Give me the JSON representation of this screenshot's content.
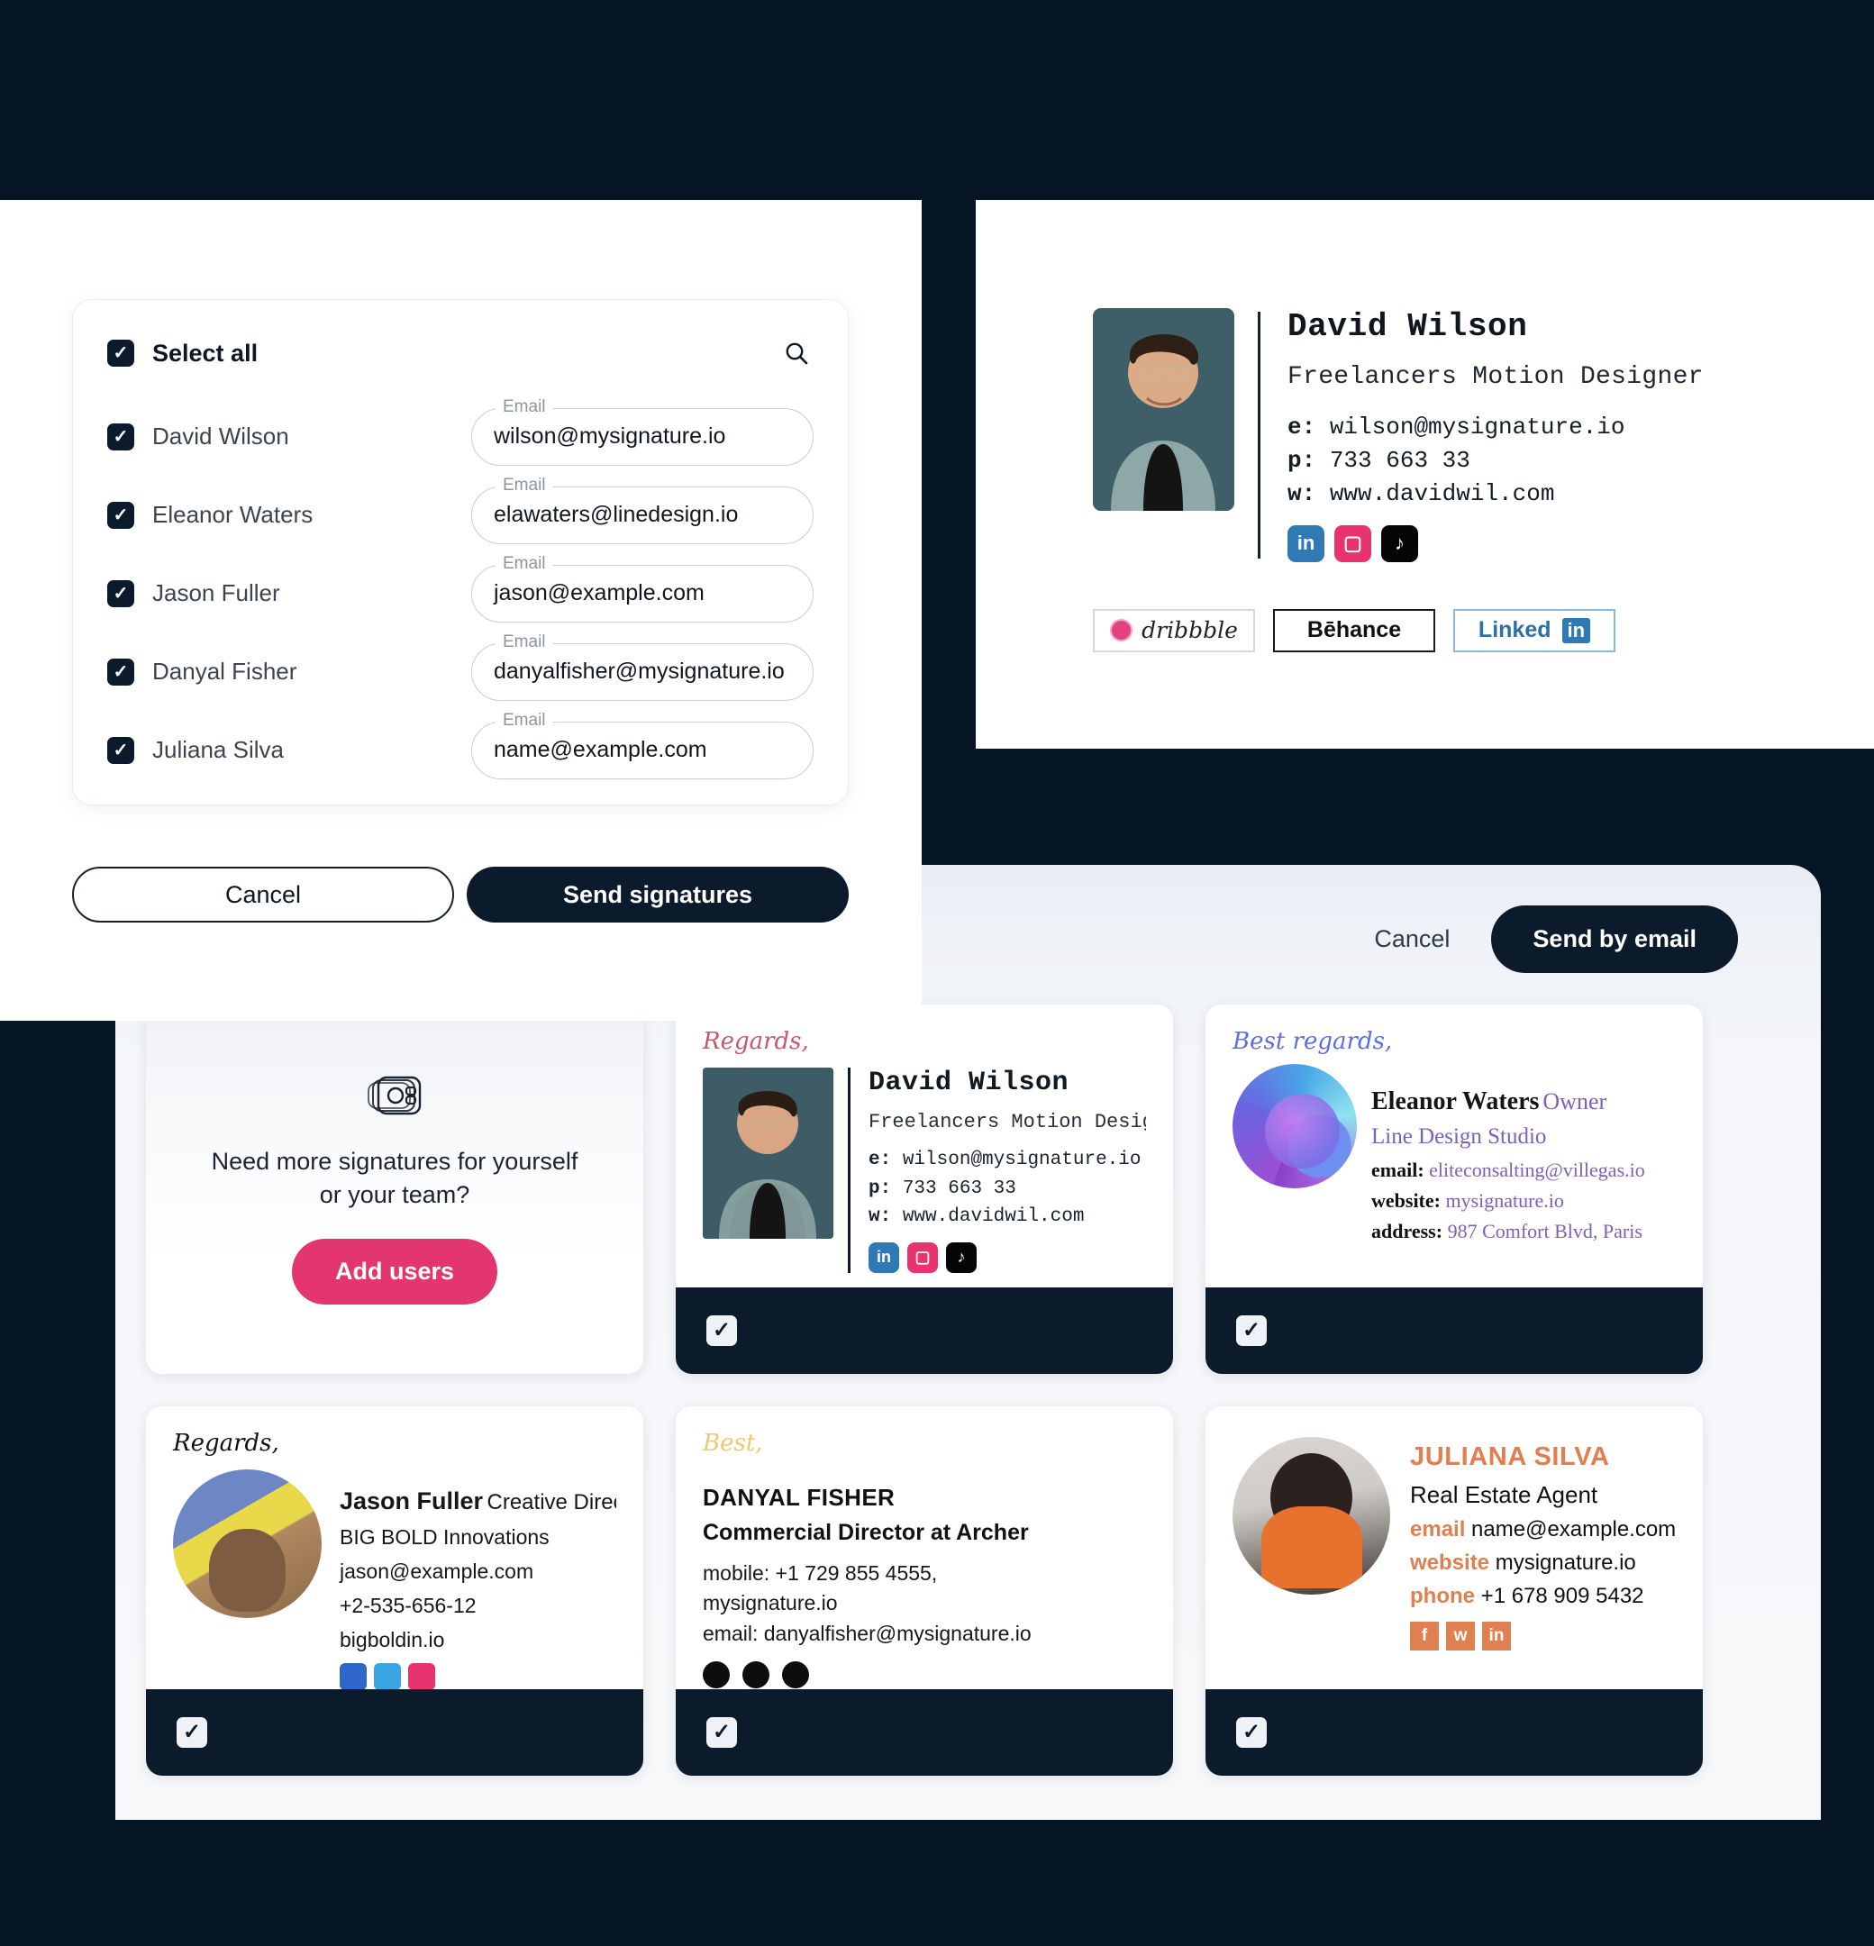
{
  "theme": {
    "background": "#051523",
    "panel": "#ffffff",
    "dark": "#0b1b2b",
    "accent_pink": "#e4366e",
    "grid_bg": "#f4f6f9"
  },
  "modal": {
    "select_all_label": "Select all",
    "search_icon": "search-icon",
    "select_all_checked": true,
    "rows": [
      {
        "name": "David Wilson",
        "checked": true,
        "email_label": "Email",
        "email_value": "wilson@mysignature.io"
      },
      {
        "name": "Eleanor Waters",
        "checked": true,
        "email_label": "Email",
        "email_value": "elawaters@linedesign.io"
      },
      {
        "name": "Jason Fuller",
        "checked": true,
        "email_label": "Email",
        "email_value": "jason@example.com"
      },
      {
        "name": "Danyal Fisher",
        "checked": true,
        "email_label": "Email",
        "email_value": "danyalfisher@mysignature.io"
      },
      {
        "name": "Juliana Silva",
        "checked": true,
        "email_label": "Email",
        "email_value": "name@example.com"
      }
    ],
    "cancel_label": "Cancel",
    "send_label": "Send signatures"
  },
  "preview": {
    "name": "David Wilson",
    "title": "Freelancers Motion Designer",
    "contact": [
      {
        "key": "e:",
        "value": "wilson@mysignature.io"
      },
      {
        "key": "p:",
        "value": "733 663 33"
      },
      {
        "key": "w:",
        "value": "www.davidwil.com"
      }
    ],
    "social": [
      {
        "icon": "linkedin-icon",
        "glyph": "in"
      },
      {
        "icon": "instagram-icon",
        "glyph": "▢"
      },
      {
        "icon": "tiktok-icon",
        "glyph": "♪"
      }
    ],
    "badges": [
      {
        "icon": "dribbble-icon",
        "label": "dribbble"
      },
      {
        "icon": "behance-icon",
        "label": "Bēhance"
      },
      {
        "icon": "linkedin-icon",
        "label": "Linked",
        "suffix": "in"
      }
    ]
  },
  "grid": {
    "cancel_label": "Cancel",
    "send_label": "Send by email",
    "promo": {
      "icon": "signature-stack-icon",
      "icon_text": "08",
      "line1": "Need more signatures for yourself",
      "line2": "or your team?",
      "button_label": "Add users"
    },
    "cards": [
      {
        "id": "david-wilson",
        "style": "mono",
        "greeting": "Regards,",
        "greeting_color": "#c9566a",
        "name": "David Wilson",
        "title": "Freelancers Motion Designer",
        "lines": [
          {
            "key": "e:",
            "value": "wilson@mysignature.io"
          },
          {
            "key": "p:",
            "value": "733 663 33"
          },
          {
            "key": "w:",
            "value": "www.davidwil.com"
          }
        ],
        "checked": true
      },
      {
        "id": "eleanor-waters",
        "style": "serif",
        "greeting": "Best regards,",
        "greeting_color": "#5b6fe0",
        "name": "Eleanor Waters",
        "role": "Owner",
        "company": "Line Design Studio",
        "lines": [
          {
            "key": "email:",
            "value": "eliteconsalting@villegas.io"
          },
          {
            "key": "website:",
            "value": "mysignature.io"
          },
          {
            "key": "address:",
            "value": "987 Comfort Blvd, Paris"
          }
        ],
        "checked": true
      },
      {
        "id": "jason-fuller",
        "style": "sans",
        "greeting": "Regards,",
        "greeting_color": "#121212",
        "name": "Jason Fuller",
        "role": "Creative Director",
        "company": "BIG BOLD Innovations",
        "lines": [
          "jason@example.com",
          "+2-535-656-12",
          "bigboldin.io"
        ],
        "social_colors": [
          "#2f66c9",
          "#3aa5e0",
          "#e8336e"
        ],
        "checked": true
      },
      {
        "id": "danyal-fisher",
        "style": "sans",
        "greeting": "Best,",
        "greeting_color": "#e8cb6b",
        "name": "DANYAL FISHER",
        "role": "Commercial Director at Archer",
        "lines": [
          "mobile: +1 729 855 4555,",
          "mysignature.io",
          "email: danyalfisher@mysignature.io"
        ],
        "checked": true
      },
      {
        "id": "juliana-silva",
        "style": "sans",
        "name": "JULIANA SILVA",
        "role": "Real Estate Agent",
        "lines": [
          {
            "key": "email",
            "value": "name@example.com"
          },
          {
            "key": "website",
            "value": "mysignature.io"
          },
          {
            "key": "phone",
            "value": "+1 678 909 5432"
          }
        ],
        "social": [
          {
            "icon": "facebook-icon",
            "glyph": "f"
          },
          {
            "icon": "twitter-icon",
            "glyph": "ᵗ"
          },
          {
            "icon": "linkedin-icon",
            "glyph": "in"
          }
        ],
        "accent": "#e08050",
        "checked": true
      }
    ]
  }
}
